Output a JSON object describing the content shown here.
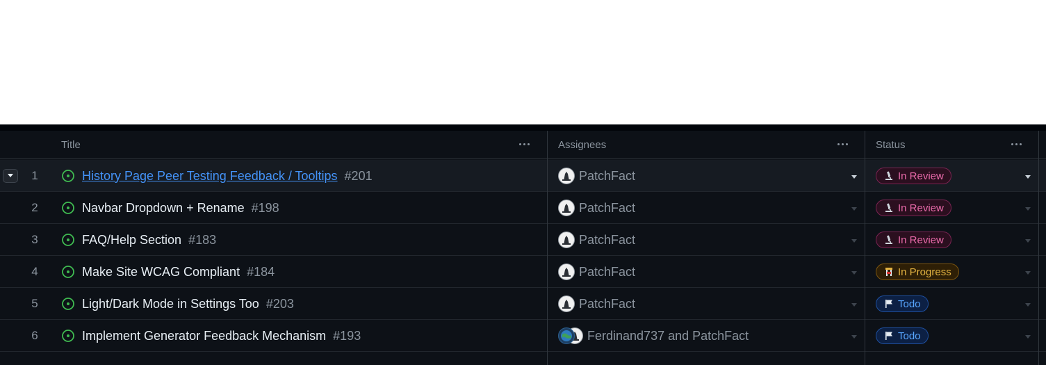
{
  "columns": {
    "title": "Title",
    "assignees": "Assignees",
    "status": "Status"
  },
  "rows": [
    {
      "number": "1",
      "title": "History Page Peer Testing Feedback / Tooltips",
      "issue": "#201",
      "assignees": "PatchFact",
      "status": "In Review"
    },
    {
      "number": "2",
      "title": "Navbar Dropdown + Rename",
      "issue": "#198",
      "assignees": "PatchFact",
      "status": "In Review"
    },
    {
      "number": "3",
      "title": "FAQ/Help Section",
      "issue": "#183",
      "assignees": "PatchFact",
      "status": "In Review"
    },
    {
      "number": "4",
      "title": "Make Site WCAG Compliant",
      "issue": "#184",
      "assignees": "PatchFact",
      "status": "In Progress"
    },
    {
      "number": "5",
      "title": "Light/Dark Mode in Settings Too",
      "issue": "#203",
      "assignees": "PatchFact",
      "status": "Todo"
    },
    {
      "number": "6",
      "title": "Implement Generator Feedback Mechanism",
      "issue": "#193",
      "assignees": "Ferdinand737 and PatchFact",
      "status": "Todo"
    }
  ],
  "icons": {
    "issue": "open-issue-circle-icon",
    "in_review": "microscope-icon",
    "in_progress": "construction-icon",
    "todo": "flag-icon"
  },
  "colors": {
    "background": "#0d1117",
    "open_issue": "#3fb950",
    "link": "#4493f8",
    "in_review": "#e86aa9",
    "in_progress": "#e3b341",
    "todo": "#58a6ff"
  }
}
